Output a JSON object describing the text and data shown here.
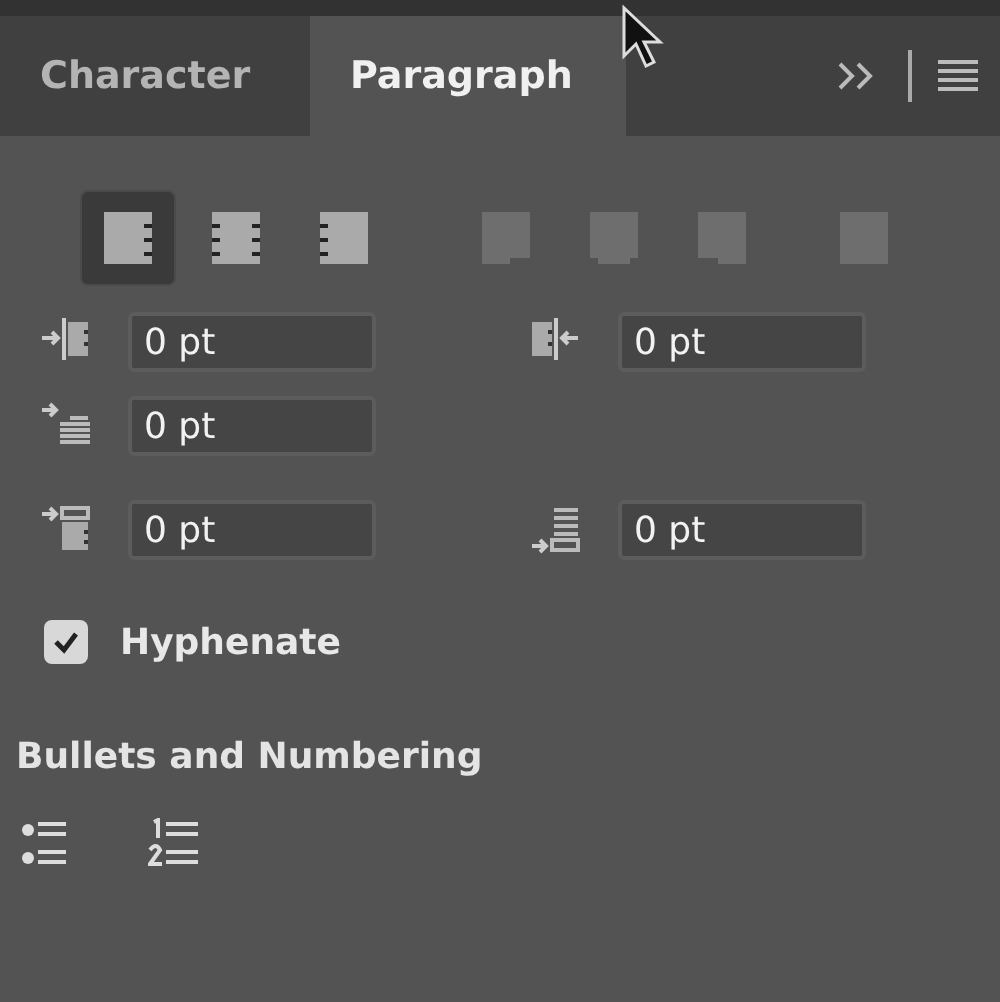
{
  "tabs": [
    {
      "label": "Character",
      "selected": false
    },
    {
      "label": "Paragraph",
      "selected": true
    }
  ],
  "alignment_buttons": [
    {
      "kind": "left",
      "selected": true,
      "disabled": false
    },
    {
      "kind": "center",
      "selected": false,
      "disabled": false
    },
    {
      "kind": "right",
      "selected": false,
      "disabled": false
    },
    {
      "kind": "justify-left",
      "selected": false,
      "disabled": true
    },
    {
      "kind": "justify-center",
      "selected": false,
      "disabled": true
    },
    {
      "kind": "justify-right",
      "selected": false,
      "disabled": true
    },
    {
      "kind": "justify-all",
      "selected": false,
      "disabled": true
    }
  ],
  "field_rows": [
    [
      {
        "kind": "left-indent",
        "value": "0 pt"
      },
      {
        "kind": "right-indent",
        "value": "0 pt"
      }
    ],
    [
      {
        "kind": "first-line-indent",
        "value": "0 pt"
      }
    ],
    [
      {
        "kind": "space-before",
        "value": "0 pt"
      },
      {
        "kind": "space-after",
        "value": "0 pt"
      }
    ]
  ],
  "hyphenate": {
    "label": "Hyphenate",
    "checked": true
  },
  "bullets": {
    "heading": "Bullets and Numbering",
    "buttons": [
      {
        "kind": "bulleted"
      },
      {
        "kind": "numbered"
      }
    ]
  }
}
